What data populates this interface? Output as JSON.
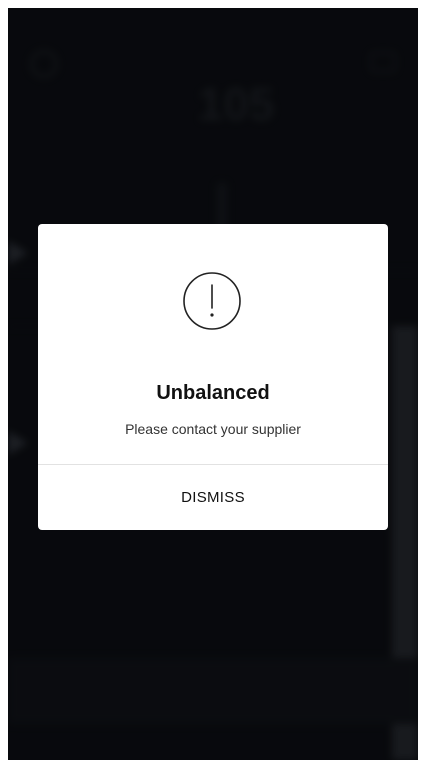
{
  "background": {
    "speed_value": "105",
    "colors": {
      "screen": "#0d0f14",
      "accent_panel": "#3a3e45"
    }
  },
  "dialog": {
    "icon": "exclamation-circle-icon",
    "title": "Unbalanced",
    "message": "Please contact your supplier",
    "dismiss_label": "DISMISS"
  }
}
